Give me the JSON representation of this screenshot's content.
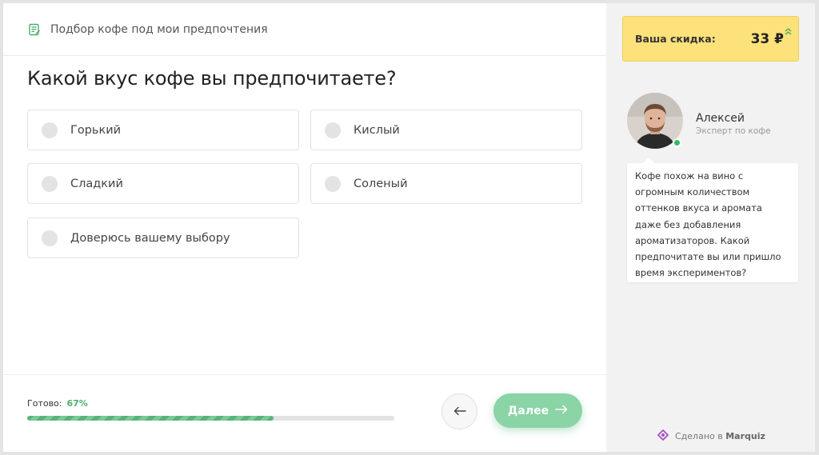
{
  "header": {
    "title": "Подбор кофе под мои предпочтения",
    "icon": "document-edit-icon"
  },
  "question": {
    "title": "Какой вкус кофе вы предпочитаете?",
    "options": [
      {
        "label": "Горький"
      },
      {
        "label": "Кислый"
      },
      {
        "label": "Сладкий"
      },
      {
        "label": "Соленый"
      },
      {
        "label": "Доверюсь вашему выбору"
      }
    ]
  },
  "progress": {
    "label": "Готово:",
    "percent_text": "67%",
    "value": 0.67
  },
  "nav": {
    "back_icon": "arrow-left-icon",
    "next_label": "Далее",
    "next_icon": "arrow-right-icon"
  },
  "discount": {
    "label": "Ваша скидка:",
    "value": "33 ₽",
    "icon": "chevrons-up-icon"
  },
  "expert": {
    "name": "Алексей",
    "role": "Эксперт по кофе",
    "message_lines": [
      "Кофе похож на вино с",
      "огромным количеством",
      "оттенков вкуса и аромата",
      "даже без добавления",
      "ароматизаторов. Какой",
      "предпочитате вы или пришло",
      "время экспериментов?"
    ]
  },
  "footer_brand": {
    "prefix": "Сделано в",
    "brand": "Marquiz",
    "icon": "marquiz-logo-icon"
  },
  "colors": {
    "accent_green": "#8ad4a5",
    "progress_green": "#58b37a",
    "discount_yellow": "#fde17a",
    "sidebar_bg": "#f2f2f2"
  }
}
